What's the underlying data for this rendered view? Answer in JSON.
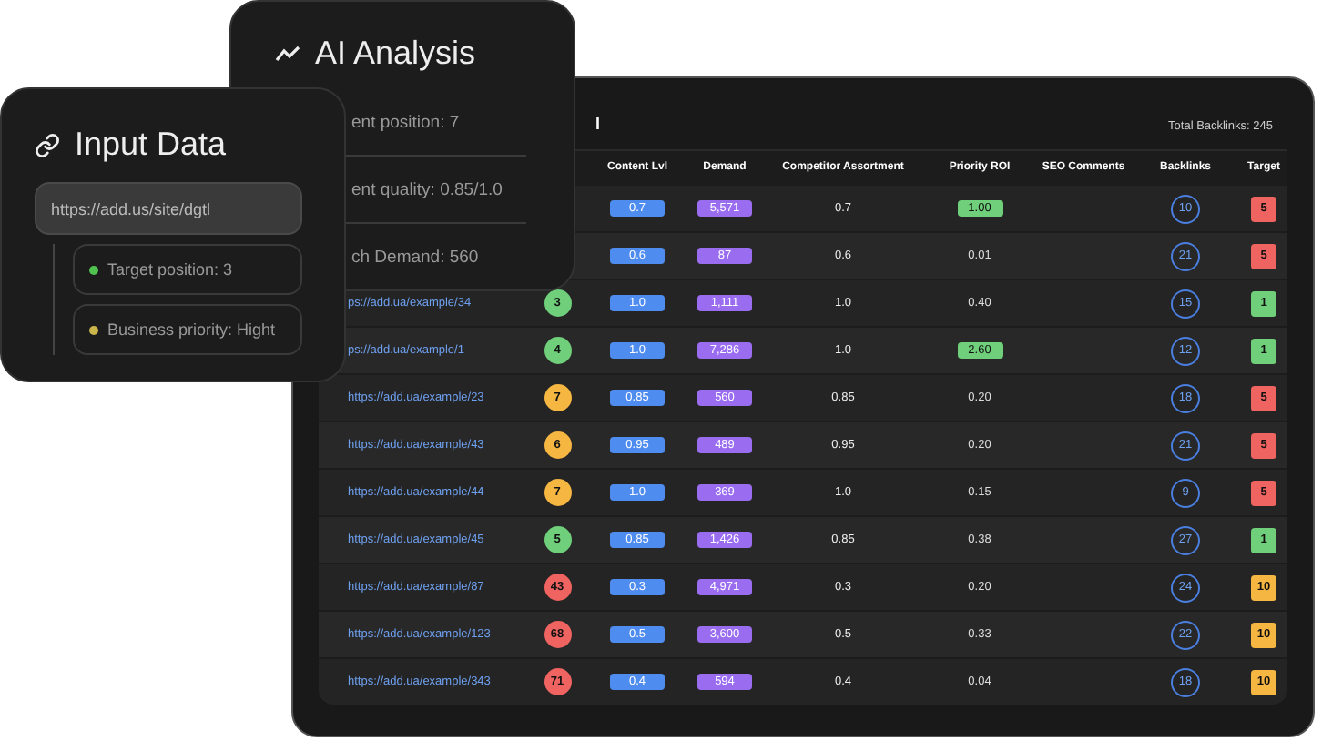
{
  "ai_analysis": {
    "title": "AI Analysis",
    "items": [
      "ent position: 7",
      "ent quality: 0.85/1.0",
      "ch Demand: 560"
    ]
  },
  "input_data": {
    "title": "Input Data",
    "url": "https://add.us/site/dgtl",
    "params": [
      {
        "label": "Target position: 3",
        "color": "#4fc24f"
      },
      {
        "label": "Business priority: Hight",
        "color": "#c9b54a"
      }
    ]
  },
  "table": {
    "title": "l",
    "total": "Total Backlinks: 245",
    "columns": [
      "Content Lvl",
      "Demand",
      "Competitor Assortment",
      "Priority ROI",
      "SEO Comments",
      "Backlinks",
      "Target"
    ],
    "rows": [
      {
        "content": "0.7",
        "demand": "5,571",
        "competitor": "0.7",
        "roi": "1.00",
        "roi_highlighted": true,
        "backlinks": "10",
        "target": {
          "text": "5",
          "color": "#ef6461"
        }
      },
      {
        "content": "0.6",
        "demand": "87",
        "competitor": "0.6",
        "roi": "0.01",
        "roi_highlighted": false,
        "backlinks": "21",
        "target": {
          "text": "5",
          "color": "#ef6461"
        }
      },
      {
        "url": "ps://add.ua/example/34",
        "rank": {
          "text": "3",
          "color": "#6fcf7a"
        },
        "content": "1.0",
        "demand": "1,111",
        "competitor": "1.0",
        "roi": "0.40",
        "roi_highlighted": false,
        "backlinks": "15",
        "target": {
          "text": "1",
          "color": "#6fcf7a"
        }
      },
      {
        "url": "ps://add.ua/example/1",
        "rank": {
          "text": "4",
          "color": "#6fcf7a"
        },
        "content": "1.0",
        "demand": "7,286",
        "competitor": "1.0",
        "roi": "2.60",
        "roi_highlighted": true,
        "backlinks": "12",
        "target": {
          "text": "1",
          "color": "#6fcf7a"
        }
      },
      {
        "url": "https://add.ua/example/23",
        "rank": {
          "text": "7",
          "color": "#f5b642"
        },
        "content": "0.85",
        "demand": "560",
        "competitor": "0.85",
        "roi": "0.20",
        "roi_highlighted": false,
        "backlinks": "18",
        "target": {
          "text": "5",
          "color": "#ef6461"
        }
      },
      {
        "url": "https://add.ua/example/43",
        "rank": {
          "text": "6",
          "color": "#f5b642"
        },
        "content": "0.95",
        "demand": "489",
        "competitor": "0.95",
        "roi": "0.20",
        "roi_highlighted": false,
        "backlinks": "21",
        "target": {
          "text": "5",
          "color": "#ef6461"
        }
      },
      {
        "url": "https://add.ua/example/44",
        "rank": {
          "text": "7",
          "color": "#f5b642"
        },
        "content": "1.0",
        "demand": "369",
        "competitor": "1.0",
        "roi": "0.15",
        "roi_highlighted": false,
        "backlinks": "9",
        "target": {
          "text": "5",
          "color": "#ef6461"
        }
      },
      {
        "url": "https://add.ua/example/45",
        "rank": {
          "text": "5",
          "color": "#6fcf7a"
        },
        "content": "0.85",
        "demand": "1,426",
        "competitor": "0.85",
        "roi": "0.38",
        "roi_highlighted": false,
        "backlinks": "27",
        "target": {
          "text": "1",
          "color": "#6fcf7a"
        }
      },
      {
        "url": "https://add.ua/example/87",
        "rank": {
          "text": "43",
          "color": "#ef6461"
        },
        "content": "0.3",
        "demand": "4,971",
        "competitor": "0.3",
        "roi": "0.20",
        "roi_highlighted": false,
        "backlinks": "24",
        "target": {
          "text": "10",
          "color": "#f5b642"
        }
      },
      {
        "url": "https://add.ua/example/123",
        "rank": {
          "text": "68",
          "color": "#ef6461"
        },
        "content": "0.5",
        "demand": "3,600",
        "competitor": "0.5",
        "roi": "0.33",
        "roi_highlighted": false,
        "backlinks": "22",
        "target": {
          "text": "10",
          "color": "#f5b642"
        }
      },
      {
        "url": "https://add.ua/example/343",
        "rank": {
          "text": "71",
          "color": "#ef6461"
        },
        "content": "0.4",
        "demand": "594",
        "competitor": "0.4",
        "roi": "0.04",
        "roi_highlighted": false,
        "backlinks": "18",
        "target": {
          "text": "10",
          "color": "#f5b642"
        }
      }
    ]
  }
}
